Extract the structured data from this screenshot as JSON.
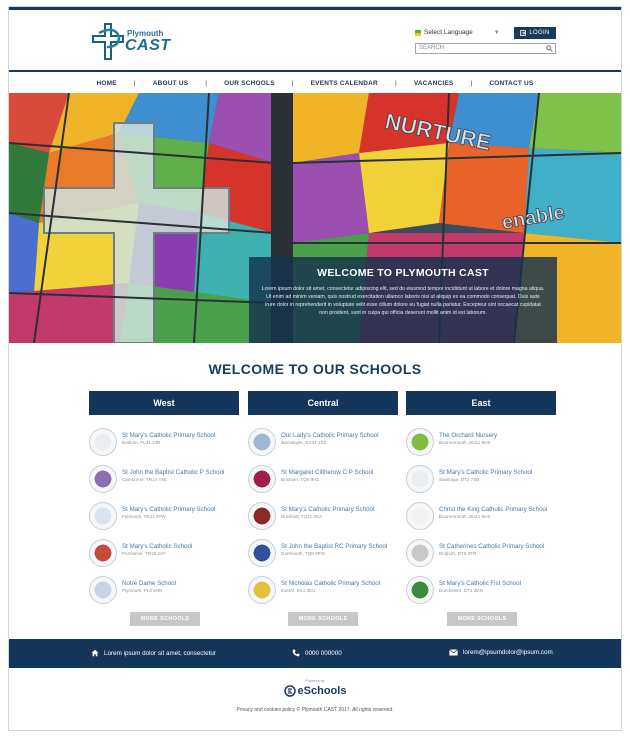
{
  "header": {
    "brand_small": "Plymouth",
    "brand_big": "CAST",
    "language_label": "Select Language",
    "login_label": "LOGIN",
    "search_placeholder": "SEARCH"
  },
  "nav": [
    "HOME",
    "ABOUT US",
    "OUR SCHOOLS",
    "EVENTS CALENDAR",
    "VACANCIES",
    "CONTACT US"
  ],
  "hero": {
    "window_words": [
      "NURTURE",
      "enable"
    ],
    "title": "WELCOME TO PLYMOUTH CAST",
    "body": "Lorem ipsum dolor sit amet, consectetur adipiscing elit, sed do eiusmod tempor incididunt ut labore et dolore magna aliqua. Ut enim ad minim veniam, quis nostrud exercitation ullamco laboris nisi ut aliquip ex ea commodo consequat. Duis aute irure dolor in reprehenderit in voluptate velit esse cillum dolore eu fugiat nulla pariatur. Excepteur sint occaecat cupidatat non proident, sunt in culpa qui officia deserunt mollit anim id est laborum."
  },
  "schools": {
    "title": "WELCOME TO OUR SCHOOLS",
    "more_label": "MORE SCHOOLS",
    "columns": [
      {
        "heading": "West",
        "items": [
          {
            "name": "St Mary's Catholic Primary School",
            "addr": "Bodmin, PL31 2JR",
            "color": "#e9eef3"
          },
          {
            "name": "St John the Baptist Catholic P School",
            "addr": "Camborne, TR14 7AE",
            "color": "#8a6fb3"
          },
          {
            "name": "St Mary's Catholic Primary School",
            "addr": "Falmouth, TR11 4PW",
            "color": "#d8e4f2"
          },
          {
            "name": "St Mary's Catholic School",
            "addr": "Penzance, TR18 2AT",
            "color": "#c84a3a"
          },
          {
            "name": "Notre Dame School",
            "addr": "Plymouth, PL6 5HN",
            "color": "#c7d3e6"
          }
        ]
      },
      {
        "heading": "Central",
        "items": [
          {
            "name": "Our Lady's Catholic Primary School",
            "addr": "Barnstaple, EX31 1EZ",
            "color": "#9bb7d4"
          },
          {
            "name": "St Margaret Clitherow C P School",
            "addr": "Brixham, TQ5 9HZ",
            "color": "#a31d4b"
          },
          {
            "name": "St Mary's Catholic Primary School",
            "addr": "Buckfast, TQ11 0EA",
            "color": "#8a2a2a"
          },
          {
            "name": "St John the Baptist RC Primary School",
            "addr": "Dartmouth, TQ6 9PW",
            "color": "#2f4fa0"
          },
          {
            "name": "St Nicholas Catholic Primary School",
            "addr": "Exeter, EX1 3EU",
            "color": "#e3c23a"
          }
        ]
      },
      {
        "heading": "East",
        "items": [
          {
            "name": "The Orchard Nursery",
            "addr": "Bournemouth, BH11 9HS",
            "color": "#7fbf3f"
          },
          {
            "name": "St Mary's Catholic Primary School",
            "addr": "Swanage, DT2 7SB",
            "color": "#e9eef3"
          },
          {
            "name": "Christ the King Catholic Primary School",
            "addr": "Bournemouth, BH11 9HX",
            "color": "#f2f2f2"
          },
          {
            "name": "St Catherines Catholic Primary School",
            "addr": "Bridport, DT6 3TR",
            "color": "#c9c9c9"
          },
          {
            "name": "St Mary's Catholic Fist School",
            "addr": "Dorchester, DT1 2DN",
            "color": "#3c8a3c"
          }
        ]
      }
    ]
  },
  "footer": {
    "address": "Lorem ipsum dolor sit amet, consectetur",
    "phone": "0000 000000",
    "email": "lorem@ipsumdolor@ipsum.com",
    "powered_by": "Powered by",
    "powered_logo": "eSchools",
    "copyright": "Privacy and cookies policy © Plymouth CAST 2017. All rights reserved."
  },
  "colors": {
    "primary": "#14355a",
    "accent": "#1d6f8b",
    "link": "#4378a8"
  }
}
